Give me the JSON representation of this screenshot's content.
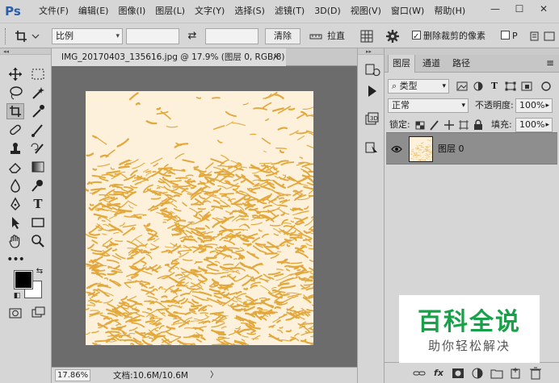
{
  "app": {
    "logo": "Ps",
    "menu": [
      "文件(F)",
      "编辑(E)",
      "图像(I)",
      "图层(L)",
      "文字(Y)",
      "选择(S)",
      "滤镜(T)",
      "3D(D)",
      "视图(V)",
      "窗口(W)",
      "帮助(H)"
    ],
    "window_controls": {
      "minimize": "—",
      "restore": "☐",
      "close": "✕"
    }
  },
  "options": {
    "ratio_select": "比例",
    "swap_symbol": "⇄",
    "clear_button": "清除",
    "straighten_label": "拉直",
    "delete_cropped_label": "删除裁剪的像素",
    "delete_cropped_checked": true,
    "extra_char": "P"
  },
  "document": {
    "tab_title": "IMG_20170403_135616.jpg @ 17.9% (图层 0, RGB/8) *",
    "tab_close": "×",
    "zoom": "17.86%",
    "doc_info": "文档:10.6M/10.6M",
    "status_arrow": "〉"
  },
  "layers_panel": {
    "tabs": [
      "图层",
      "通道",
      "路径"
    ],
    "active_tab": "图层",
    "filter_kind": "类型",
    "blend_mode": "正常",
    "opacity_label": "不透明度:",
    "opacity_value": "100%",
    "lock_label": "锁定:",
    "fill_label": "填充:",
    "fill_value": "100%",
    "layers": [
      {
        "name": "图层 0",
        "visible": true
      }
    ],
    "footer_fx": "fx"
  },
  "watermark": {
    "title": "百科全说",
    "subtitle": "助你轻松解决",
    "color": "#17a24a"
  },
  "tools": [
    "move-tool",
    "marquee-tool",
    "lasso-tool",
    "magic-wand-tool",
    "crop-tool",
    "eyedropper-tool",
    "healing-brush-tool",
    "brush-tool",
    "clone-stamp-tool",
    "history-brush-tool",
    "eraser-tool",
    "gradient-tool",
    "blur-tool",
    "dodge-tool",
    "pen-tool",
    "type-tool",
    "path-selection-tool",
    "rectangle-tool",
    "hand-tool",
    "zoom-tool",
    "more-tools"
  ],
  "colors": {
    "foreground": "#000000",
    "background": "#ffffff",
    "canvas_bg": "#fdf1dc",
    "line_art": "#e3a83c"
  }
}
